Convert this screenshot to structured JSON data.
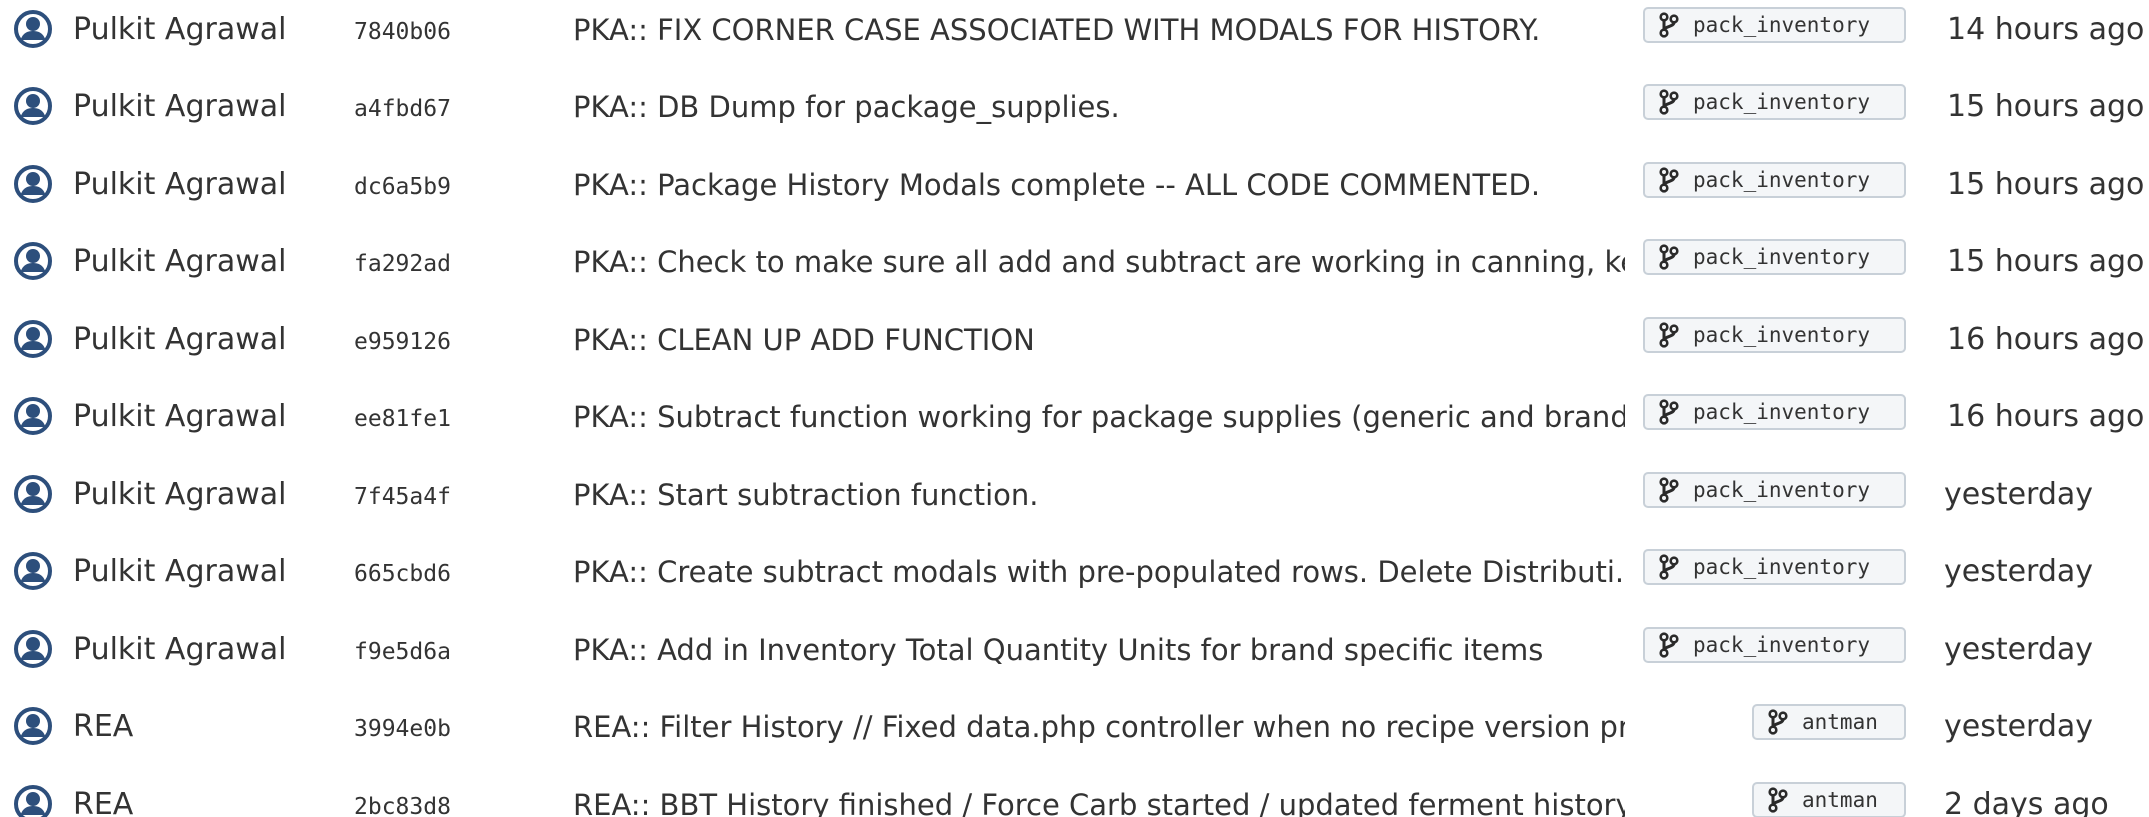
{
  "commits": [
    {
      "author": "Pulkit Agrawal",
      "hash": "7840b06",
      "message": "PKA:: FIX CORNER CASE ASSOCIATED WITH MODALS FOR HISTORY.",
      "branch": "pack_inventory",
      "time": "14 hours ago"
    },
    {
      "author": "Pulkit Agrawal",
      "hash": "a4fbd67",
      "message": "PKA:: DB Dump for package_supplies.",
      "branch": "pack_inventory",
      "time": "15 hours ago"
    },
    {
      "author": "Pulkit Agrawal",
      "hash": "dc6a5b9",
      "message": "PKA:: Package History Modals complete -- ALL CODE COMMENTED.",
      "branch": "pack_inventory",
      "time": "15 hours ago"
    },
    {
      "author": "Pulkit Agrawal",
      "hash": "fa292ad",
      "message": "PKA:: Check to make sure all add and subtract are working in canning, ke...",
      "branch": "pack_inventory",
      "time": "15 hours ago"
    },
    {
      "author": "Pulkit Agrawal",
      "hash": "e959126",
      "message": "PKA:: CLEAN UP ADD FUNCTION",
      "branch": "pack_inventory",
      "time": "16 hours ago"
    },
    {
      "author": "Pulkit Agrawal",
      "hash": "ee81fe1",
      "message": "PKA:: Subtract function working for package supplies (generic and brand...",
      "branch": "pack_inventory",
      "time": "16 hours ago"
    },
    {
      "author": "Pulkit Agrawal",
      "hash": "7f45a4f",
      "message": "PKA:: Start subtraction function.",
      "branch": "pack_inventory",
      "time": "yesterday"
    },
    {
      "author": "Pulkit Agrawal",
      "hash": "665cbd6",
      "message": "PKA:: Create subtract modals with pre-populated rows. Delete Distributi...",
      "branch": "pack_inventory",
      "time": "yesterday"
    },
    {
      "author": "Pulkit Agrawal",
      "hash": "f9e5d6a",
      "message": "PKA:: Add in Inventory Total Quantity Units for brand specific items",
      "branch": "pack_inventory",
      "time": "yesterday"
    },
    {
      "author": "REA",
      "hash": "3994e0b",
      "message": "REA:: Filter History // Fixed data.php controller when no recipe version present (l...",
      "branch": "antman",
      "time": "yesterday"
    },
    {
      "author": "REA",
      "hash": "2bc83d8",
      "message": "REA:: BBT History finished / Force Carb started / updated ferment history to have...",
      "branch": "antman",
      "time": "2 days ago"
    }
  ],
  "colors": {
    "avatar": "#2d4f7c",
    "text": "#333333",
    "badge_border": "#c8d0d8",
    "badge_bg": "#f4f6f8"
  },
  "icons": {
    "avatar": "user-avatar-icon",
    "branch": "git-branch-icon"
  }
}
